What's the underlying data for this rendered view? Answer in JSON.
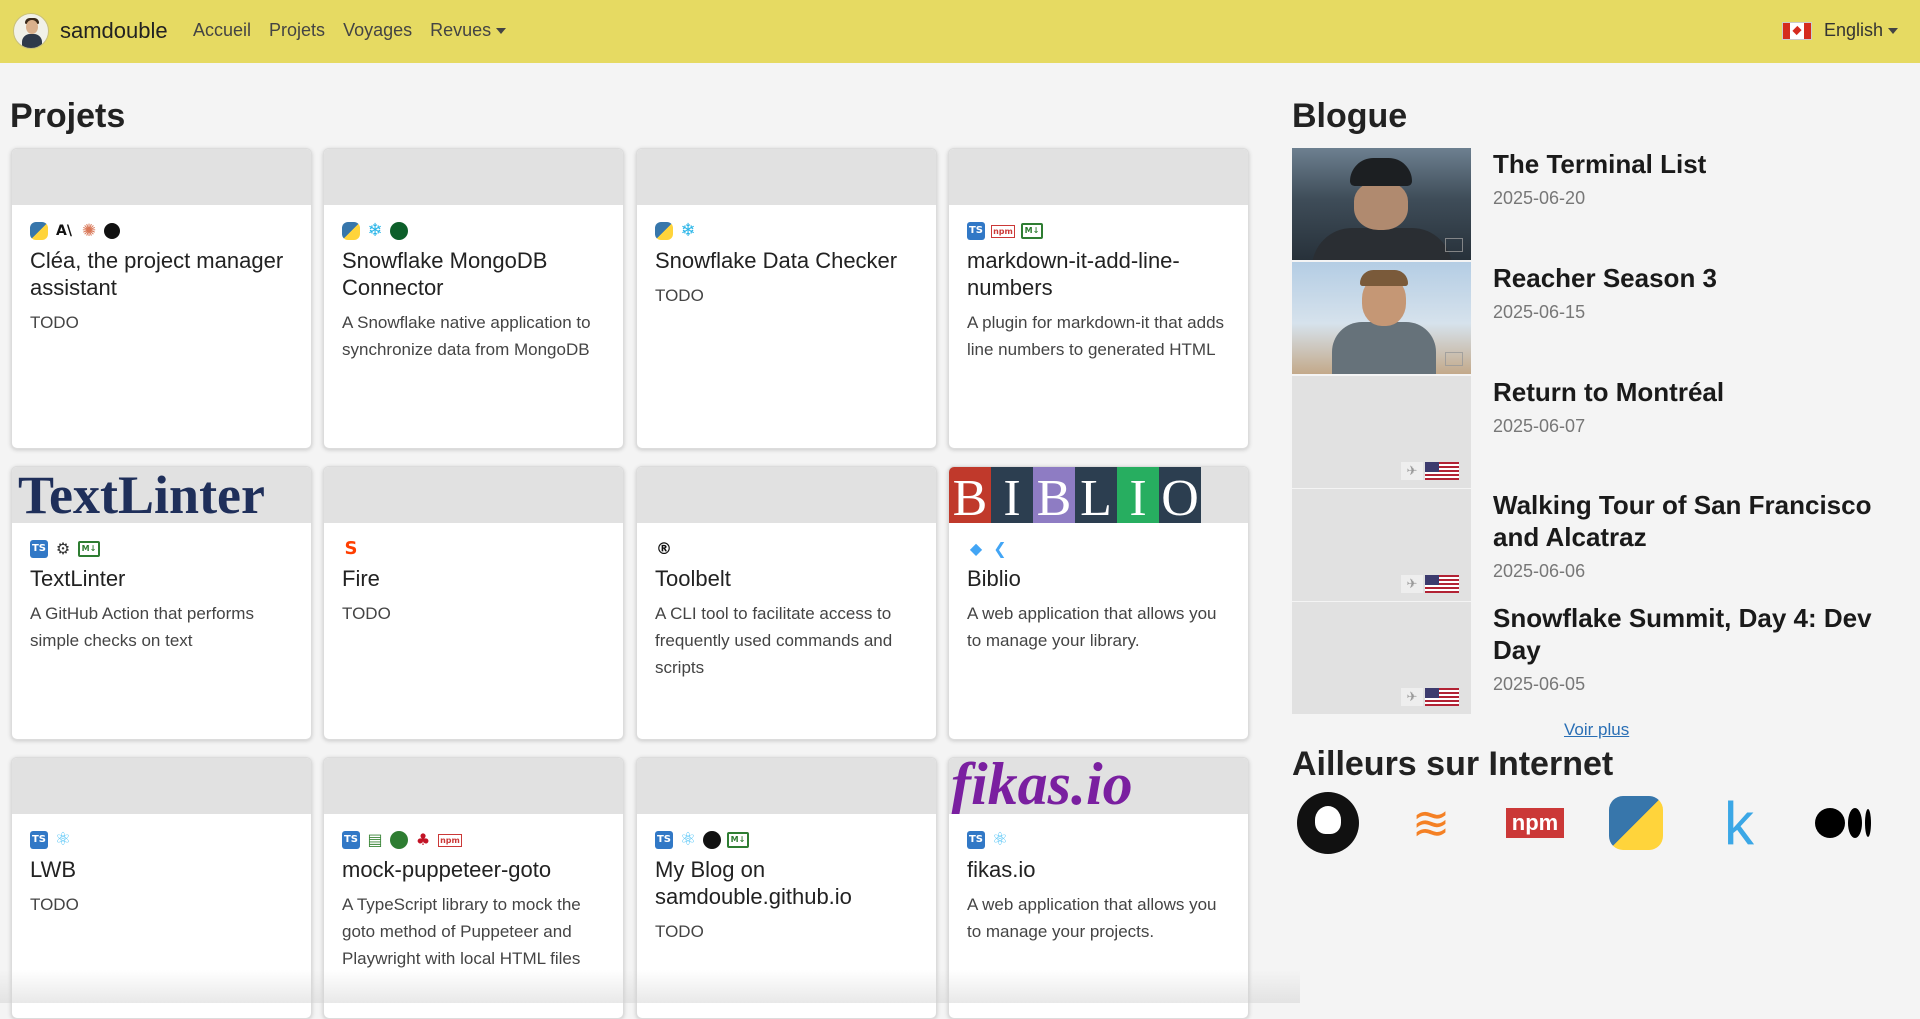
{
  "nav": {
    "brand": "samdouble",
    "links": [
      "Accueil",
      "Projets",
      "Voyages",
      "Revues"
    ],
    "language": "English"
  },
  "projects": {
    "title": "Projets",
    "cards": [
      {
        "title": "Cléa, the project manager assistant",
        "desc": "TODO",
        "icons": [
          "python-icon",
          "anthropic-icon",
          "claude-icon",
          "stripe-icon"
        ]
      },
      {
        "title": "Snowflake MongoDB Connector",
        "desc": "A Snowflake native application to synchronize data from MongoDB",
        "icons": [
          "python-icon",
          "snowflake-icon",
          "mongodb-icon"
        ]
      },
      {
        "title": "Snowflake Data Checker",
        "desc": "TODO",
        "icons": [
          "python-icon",
          "snowflake-icon"
        ]
      },
      {
        "title": "markdown-it-add-line-numbers",
        "desc": "A plugin for markdown-it that adds line numbers to generated HTML",
        "icons": [
          "typescript-icon",
          "npm-icon",
          "markdown-icon"
        ]
      },
      {
        "title": "TextLinter",
        "desc": "A GitHub Action that performs simple checks on text",
        "image_text": "TextLinter",
        "icons": [
          "typescript-icon",
          "github-actions-icon",
          "markdown-icon"
        ]
      },
      {
        "title": "Fire",
        "desc": "TODO",
        "icons": [
          "svelte-icon"
        ]
      },
      {
        "title": "Toolbelt",
        "desc": "A CLI tool to facilitate access to frequently used commands and scripts",
        "icons": [
          "rust-icon"
        ]
      },
      {
        "title": "Biblio",
        "desc": "A web application that allows you to manage your library.",
        "image_text": "BIBLIO",
        "icons": [
          "dart-icon",
          "flutter-icon"
        ]
      },
      {
        "title": "LWB",
        "desc": "TODO",
        "icons": [
          "typescript-icon",
          "react-icon"
        ]
      },
      {
        "title": "mock-puppeteer-goto",
        "desc": "A TypeScript library to mock the goto method of Puppeteer and Playwright with local HTML files",
        "icons": [
          "typescript-icon",
          "node-icon",
          "puppeteer-icon",
          "jest-icon",
          "npm-icon"
        ]
      },
      {
        "title": "My Blog on samdouble.github.io",
        "desc": "TODO",
        "icons": [
          "typescript-icon",
          "react-icon",
          "github-icon",
          "markdown-icon"
        ]
      },
      {
        "title": "fikas.io",
        "desc": "A web application that allows you to manage your projects.",
        "image_text": "fikas.io",
        "icons": [
          "typescript-icon",
          "react-icon"
        ]
      }
    ]
  },
  "blog": {
    "title": "Blogue",
    "posts": [
      {
        "title": "The Terminal List",
        "date": "2025-06-20"
      },
      {
        "title": "Reacher Season 3",
        "date": "2025-06-15"
      },
      {
        "title": "Return to Montréal",
        "date": "2025-06-07"
      },
      {
        "title": "Walking Tour of San Francisco and Alcatraz",
        "date": "2025-06-06"
      },
      {
        "title": "Snowflake Summit, Day 4: Dev Day",
        "date": "2025-06-05"
      }
    ],
    "more": "Voir plus"
  },
  "internet": {
    "title": "Ailleurs sur Internet",
    "links": [
      "github-icon",
      "stackoverflow-icon",
      "npm-icon",
      "python-icon",
      "kaggle-icon",
      "medium-icon"
    ]
  },
  "icon_glyphs": {
    "python-icon": "",
    "anthropic-icon": "A\\",
    "claude-icon": "✺",
    "stripe-icon": "",
    "snowflake-icon": "❄",
    "mongodb-icon": "",
    "typescript-icon": "TS",
    "npm-icon": "npm",
    "markdown-icon": "M↓",
    "github-actions-icon": "⚙",
    "svelte-icon": "S",
    "rust-icon": "®",
    "dart-icon": "◆",
    "flutter-icon": "❮",
    "react-icon": "⚛",
    "node-icon": "▤",
    "puppeteer-icon": "",
    "jest-icon": "♣",
    "github-icon": ""
  },
  "colors": {
    "navbar": "#e6da62",
    "link": "#2a6fb5",
    "background": "#f4f4f4"
  }
}
